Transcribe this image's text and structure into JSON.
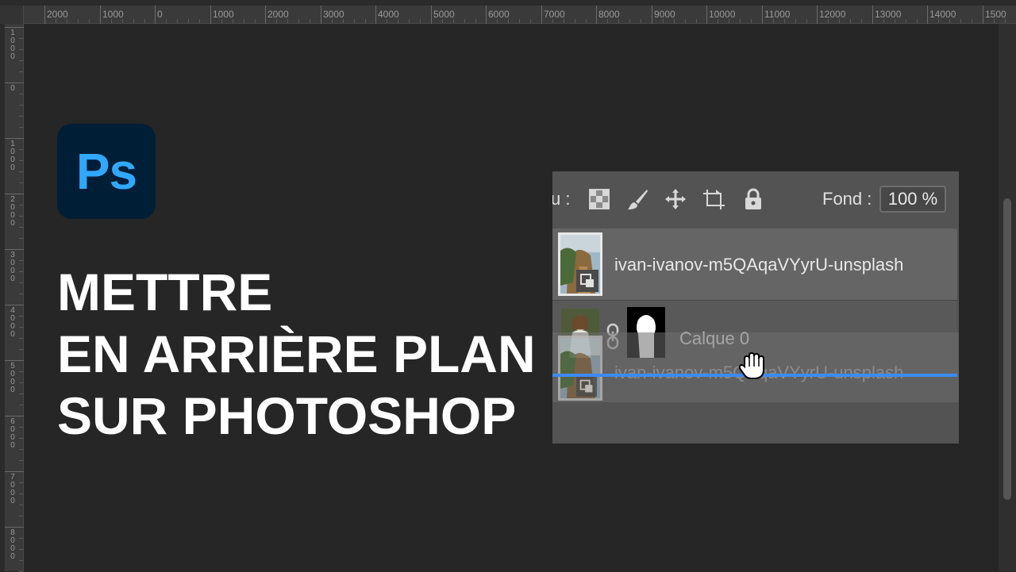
{
  "ruler": {
    "top_labels": [
      "2000",
      "1000",
      "0",
      "1000",
      "2000",
      "3000",
      "4000",
      "5000",
      "6000",
      "7000",
      "8000",
      "9000",
      "10000",
      "11000",
      "12000",
      "13000",
      "14000",
      "1500"
    ],
    "left_labels": [
      "1\n0\n0\n0",
      "0",
      "1\n0\n0\n0",
      "2\n0\n0\n0",
      "3\n0\n0\n0",
      "4\n0\n0\n0",
      "5\n0\n0\n0",
      "6\n0\n0\n0",
      "7\n0\n0\n0",
      "8\n0\n0\n0"
    ]
  },
  "logo": {
    "text": "Ps",
    "icon": "photoshop-logo-icon"
  },
  "title": {
    "line1": "METTRE",
    "line2": "EN ARRIÈRE PLAN",
    "line3": "SUR PHOTOSHOP"
  },
  "layers_panel": {
    "lock_label": "u :",
    "fill_label": "Fond :",
    "fill_value": "100 %",
    "icons": [
      "lock-transparency-icon",
      "brush-icon",
      "move-icon",
      "artboard-icon",
      "lock-icon"
    ],
    "layers": [
      {
        "name": "ivan-ivanov-m5QAqaVYyrU-unsplash",
        "type": "smart-object",
        "selected": true
      },
      {
        "name": "Calque 0",
        "type": "masked"
      },
      {
        "name": "ivan-ivanov-m5QAqaVYyrU-unsplash",
        "type": "smart-object-dragging"
      }
    ]
  },
  "colors": {
    "background": "#262626",
    "ps_blue": "#31a8ff",
    "ps_dark": "#001e36",
    "drop_line": "#3d8bf2"
  }
}
